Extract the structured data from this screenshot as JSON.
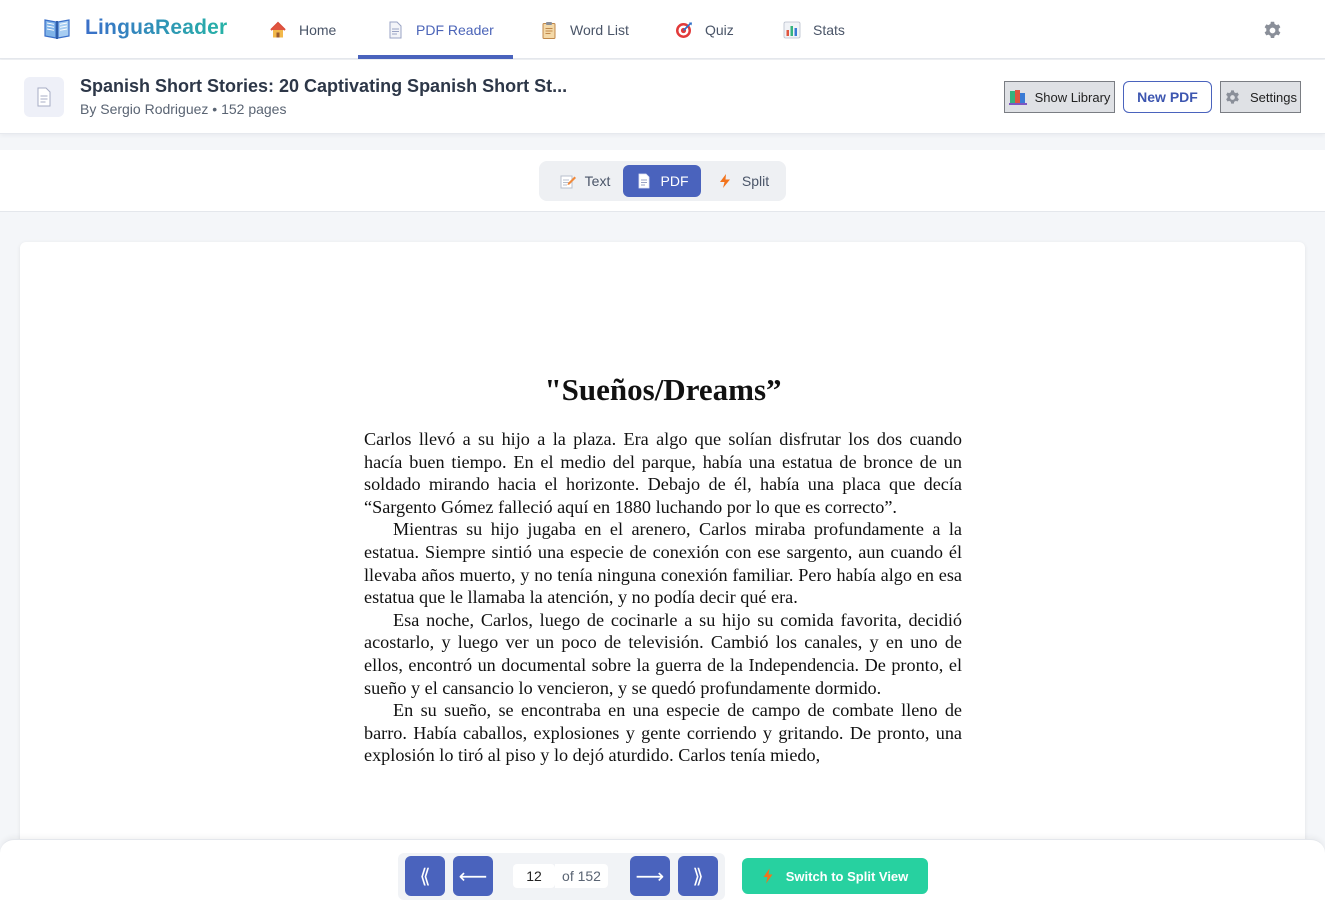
{
  "app": {
    "name": "LinguaReader",
    "logo_icon": "open-book-icon"
  },
  "nav": {
    "tabs": [
      {
        "label": "Home",
        "icon": "house-icon"
      },
      {
        "label": "PDF Reader",
        "icon": "document-icon",
        "active": true
      },
      {
        "label": "Word List",
        "icon": "clipboard-icon"
      },
      {
        "label": "Quiz",
        "icon": "target-icon"
      },
      {
        "label": "Stats",
        "icon": "bar-chart-icon"
      }
    ],
    "settings_icon": "gear-icon"
  },
  "document": {
    "title": "Spanish Short Stories: 20 Captivating Spanish Short St...",
    "subtitle": "By Sergio Rodriguez • 152 pages",
    "thumb_icon": "document-icon"
  },
  "actions": {
    "show_library": "Show Library",
    "new_pdf": "New PDF",
    "settings": "Settings"
  },
  "view_modes": [
    {
      "label": "Text",
      "icon": "pencil-memo-icon"
    },
    {
      "label": "PDF",
      "icon": "document-icon",
      "active": true
    },
    {
      "label": "Split",
      "icon": "lightning-icon"
    }
  ],
  "pdf_page": {
    "title": "\"Sueños/Dreams”",
    "paragraphs": [
      "Carlos llevó a su hijo a la plaza. Era algo que solían disfrutar los dos cuando hacía buen tiempo. En el medio del parque, había una estatua de bronce de un soldado mirando hacia el horizonte. Debajo de él, había una placa que decía “Sargento Gómez falleció aquí en 1880 luchando por lo que es correcto”.",
      "Mientras su hijo jugaba en el arenero, Carlos miraba profundamente a la estatua. Siempre sintió una especie de conexión con ese sargento, aun cuando él llevaba años muerto, y no tenía ninguna conexión familiar. Pero había algo en esa estatua que le llamaba la atención, y no podía decir qué era.",
      "Esa noche, Carlos, luego de cocinarle a su hijo su comida favorita, decidió acostarlo, y luego ver un poco de televisión. Cambió los canales, y en uno de ellos, encontró un documental sobre la guerra de la Independencia. De pronto, el sueño y el cansancio lo vencieron, y se quedó profundamente dormido.",
      "En su sueño, se encontraba en una especie de campo de combate lleno de barro. Había caballos, explosiones y gente corriendo y gritando. De pronto, una explosión lo tiró al piso y lo dejó aturdido. Carlos tenía miedo,"
    ]
  },
  "pager": {
    "first": "⟪",
    "prev": "⟵",
    "next": "⟶",
    "last": "⟫",
    "current_page": "12",
    "of_label": "of 152",
    "split_button": "Switch to Split View"
  }
}
